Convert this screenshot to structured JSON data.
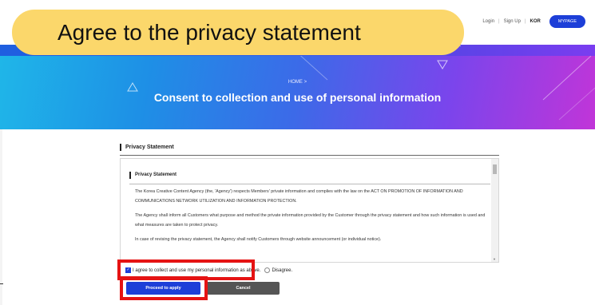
{
  "banner": {
    "text": "Agree to the privacy statement"
  },
  "topnav": {
    "login": "Login",
    "signup": "Sign Up",
    "lang": "KOR",
    "mypage": "MYPAGE",
    "sep": "|"
  },
  "hero": {
    "breadcrumb": "HOME >",
    "title": "Consent to collection and use of personal information"
  },
  "section": {
    "title": "Privacy Statement"
  },
  "statement": {
    "title": "Privacy Statement",
    "paragraphs": [
      "The Korea Creative Content Agency (the, 'Agency') respects Members' private information and complies with the law on the ACT ON PROMOTION OF INFORMATION AND COMMUNICATIONS NETWORK UTILIZATION AND INFORMATION PROTECTION.",
      "The Agency shall inform all Customers what purpose and method the private information provided by the Customer through the privacy statement and how such information is used and what measures are taken to protect privacy.",
      "In case of revising the privacy statement, the Agency shall notify Customers through website announcement (or individual notice)."
    ]
  },
  "consent": {
    "agree_label": "I agree to collect and use my personal information as above.",
    "disagree_label": "Disagree.",
    "agree_checked": true
  },
  "buttons": {
    "apply": "Proceed to apply",
    "cancel": "Cancel"
  },
  "colors": {
    "accent": "#1d3fd8",
    "highlight": "#e51313",
    "banner": "#fbd76b"
  }
}
